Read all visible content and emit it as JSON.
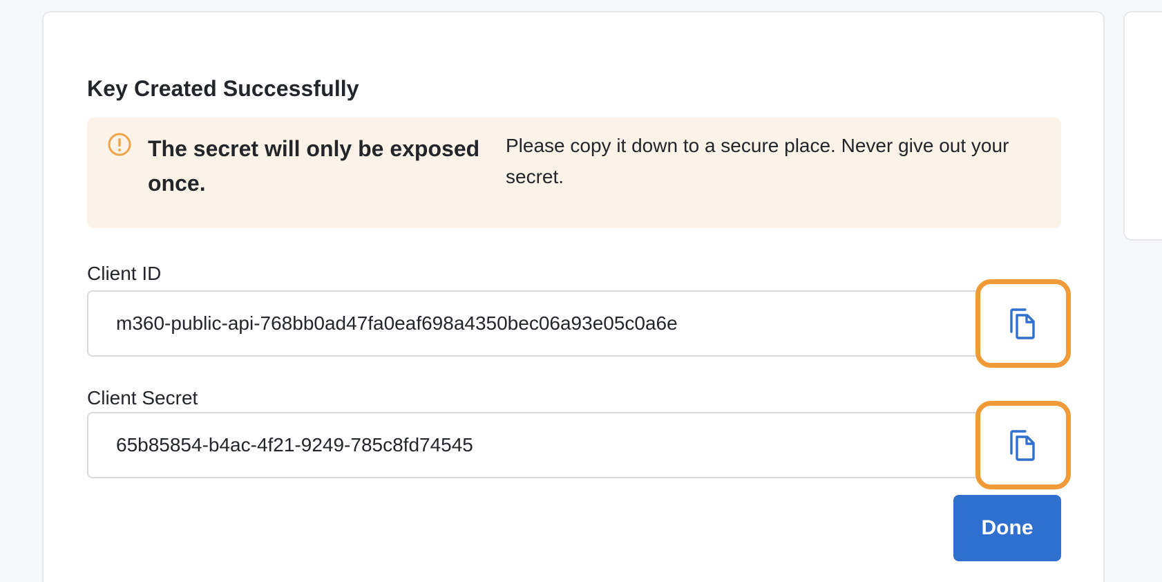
{
  "dialog": {
    "title": "Key Created Successfully",
    "alert": {
      "heading": "The secret will only be exposed once.",
      "message": "Please copy it down to a secure place. Never give out your secret.",
      "icon": "exclamation-circle-icon"
    },
    "fields": [
      {
        "label": "Client ID",
        "value": "m360-public-api-768bb0ad47fa0eaf698a4350bec06a93e05c0a6e",
        "copy_icon": "copy-icon"
      },
      {
        "label": "Client Secret",
        "value": "65b85854-b4ac-4f21-9249-785c8fd74545",
        "copy_icon": "copy-icon"
      }
    ],
    "done_label": "Done"
  },
  "colors": {
    "accent": "#2f6fd0",
    "highlight": "#f19a38",
    "alert_bg": "#fcf3e8",
    "warning": "#f0a347"
  }
}
